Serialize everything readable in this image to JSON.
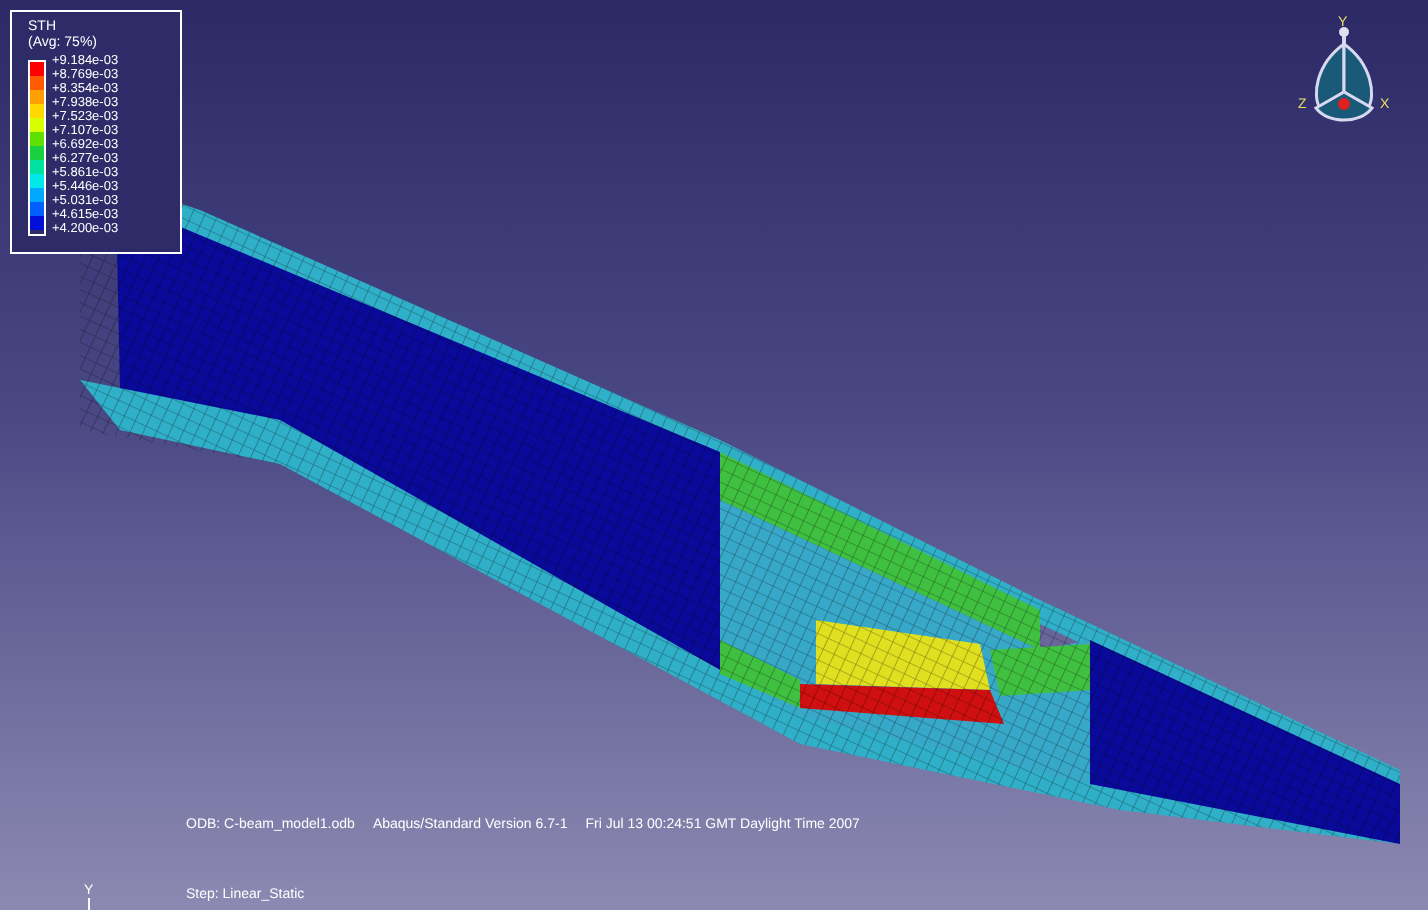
{
  "legend": {
    "title": "STH",
    "subtitle": "(Avg: 75%)",
    "bands": [
      {
        "color": "#ff0000"
      },
      {
        "color": "#ff5a00"
      },
      {
        "color": "#ffa000"
      },
      {
        "color": "#ffd800"
      },
      {
        "color": "#d8ff00"
      },
      {
        "color": "#60e000"
      },
      {
        "color": "#18d040"
      },
      {
        "color": "#00e0a0"
      },
      {
        "color": "#00e8e8"
      },
      {
        "color": "#00a8ff"
      },
      {
        "color": "#0060ff"
      },
      {
        "color": "#0010d8"
      }
    ],
    "values": [
      "+9.184e-03",
      "+8.769e-03",
      "+8.354e-03",
      "+7.938e-03",
      "+7.523e-03",
      "+7.107e-03",
      "+6.692e-03",
      "+6.277e-03",
      "+5.861e-03",
      "+5.446e-03",
      "+5.031e-03",
      "+4.615e-03",
      "+4.200e-03"
    ]
  },
  "triad": {
    "labels": [
      "Y",
      "Z",
      "X"
    ]
  },
  "info": {
    "odb": "ODB: C-beam_model1.odb",
    "version": "Abaqus/Standard Version 6.7-1",
    "date": "Fri Jul 13 00:24:51 GMT Daylight Time 2007",
    "step": "Step: Linear_Static"
  },
  "mini_triad": {
    "label": "Y"
  }
}
